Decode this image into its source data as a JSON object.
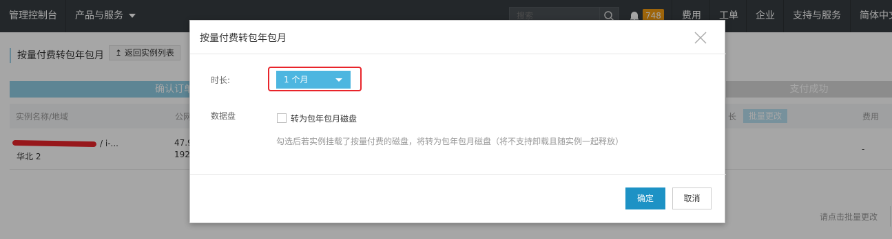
{
  "topbar": {
    "console": "管理控制台",
    "products": "产品与服务",
    "search_placeholder": "搜索",
    "notification_count": "748",
    "billing": "费用",
    "tickets": "工单",
    "enterprise": "企业",
    "support": "支持与服务",
    "language": "简体中文"
  },
  "page": {
    "title": "按量付费转包年包月",
    "back_button": "返回实例列表",
    "step_confirm": "确认订单",
    "step_success": "支付成功",
    "columns": {
      "instance": "实例名称/地域",
      "ip": "公网",
      "duration": "长",
      "batch_change": "批量更改",
      "fee": "费用"
    },
    "row": {
      "instance_suffix": "/ i-...",
      "region": "华北 2",
      "ip1": "47.9",
      "ip2": "192.",
      "fee": "-"
    },
    "batch_hint": "请点击批量更改"
  },
  "modal": {
    "title": "按量付费转包年包月",
    "duration_label": "时长:",
    "duration_value": "1 个月",
    "disk_label": "数据盘",
    "disk_checkbox_label": "转为包年包月磁盘",
    "help_text": "勾选后若实例挂载了按量付费的磁盘，将转为包年包月磁盘（将不支持卸载且随实例一起释放）",
    "ok_button": "确定",
    "cancel_button": "取消"
  },
  "colors": {
    "topbar": "#373d41",
    "primary": "#1d92c5",
    "select": "#4db6e0",
    "highlight": "#e8242a",
    "badge": "#f39c12"
  }
}
